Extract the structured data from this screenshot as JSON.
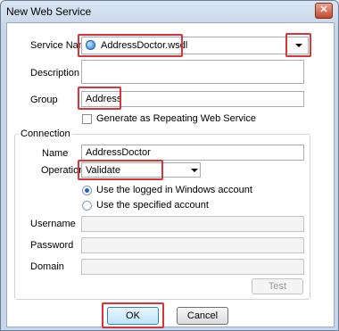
{
  "window": {
    "title": "New Web Service",
    "close_glyph": "✕"
  },
  "form": {
    "service_name_label": "Service Name",
    "service_name_value": "AddressDoctor.wsdl",
    "description_label": "Description",
    "description_value": "",
    "group_label": "Group",
    "group_value": "Address",
    "repeating_label": "Generate as Repeating Web Service",
    "repeating_checked": false
  },
  "connection": {
    "title": "Connection",
    "name_label": "Name",
    "name_value": "AddressDoctor",
    "operation_label": "Operation",
    "operation_value": "Validate",
    "radio_logged": "Use the logged in Windows account",
    "radio_specified": "Use the specified account",
    "selected_account": "logged",
    "username_label": "Username",
    "password_label": "Password",
    "domain_label": "Domain",
    "test_label": "Test"
  },
  "buttons": {
    "ok_label": "OK",
    "cancel_label": "Cancel"
  },
  "colors": {
    "highlight": "#d8343a",
    "service_icon": "#2a7fd4"
  },
  "icons": {
    "service": "web-service-icon",
    "dropdown": "chevron-down-icon"
  }
}
